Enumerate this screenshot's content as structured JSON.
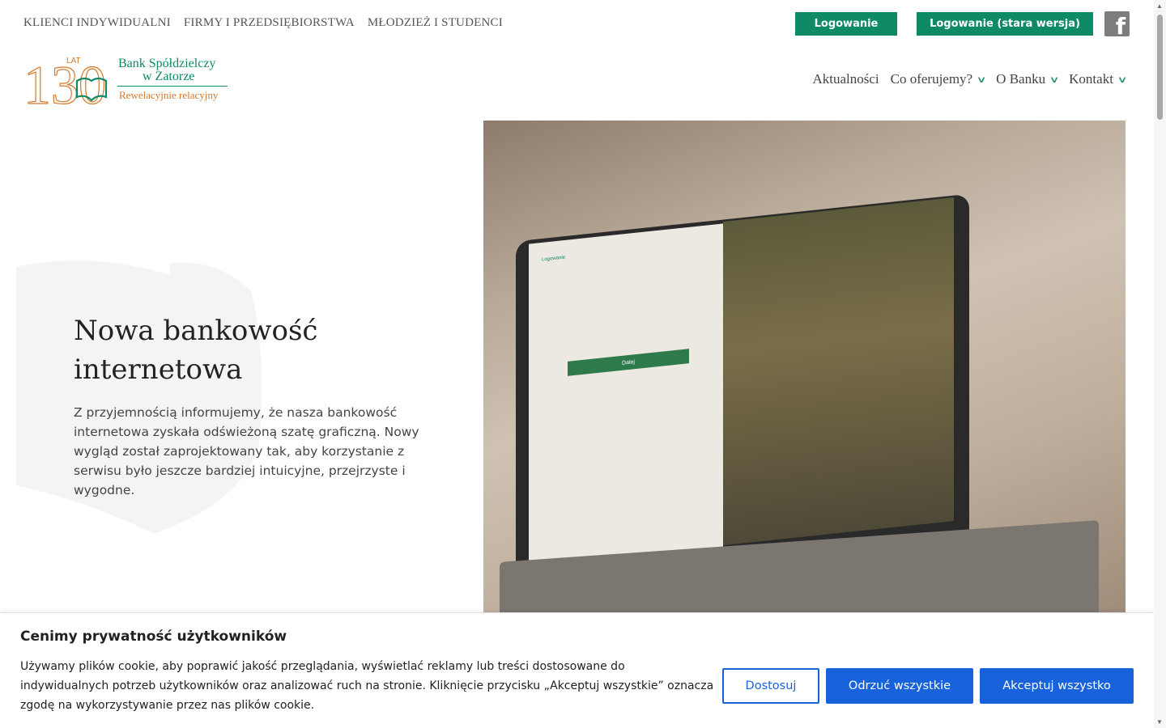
{
  "top_nav": [
    "KLIENCI INDYWIDUALNI",
    "FIRMY I PRZEDSIĘBIORSTWA",
    "MŁODZIEŻ I STUDENCI"
  ],
  "header_buttons": {
    "login": "Logowanie",
    "login_old": "Logowanie (stara wersja)"
  },
  "logo": {
    "years": "130",
    "lat": "LAT",
    "name_line1": "Bank Spółdzielczy",
    "name_line2": "w Zatorze",
    "tagline": "Rewelacyjnie relacyjny"
  },
  "main_nav": [
    "Aktualności",
    "Co oferujemy?",
    "O Banku",
    "Kontakt"
  ],
  "hero": {
    "title": "Nowa bankowość internetowa",
    "text": "Z przyjemnością informujemy, że nasza bankowość internetowa zyskała odświeżoną szatę graficzną. Nowy wygląd został zaprojektowany tak, aby korzystanie z serwisu było jeszcze bardziej intuicyjne, przejrzyste i wygodne."
  },
  "hero_screen": {
    "login": "Logowanie",
    "button": "Dalej"
  },
  "cookie": {
    "title": "Cenimy prywatność użytkowników",
    "text": "Używamy plików cookie, aby poprawić jakość przeglądania, wyświetlać reklamy lub treści dostosowane do indywidualnych potrzeb użytkowników oraz analizować ruch na stronie. Kliknięcie przycisku „Akceptuj wszystkie” oznacza zgodę na wykorzystywanie przez nas plików cookie.",
    "customize": "Dostosuj",
    "reject": "Odrzuć wszystkie",
    "accept": "Akceptuj wszystko"
  },
  "colors": {
    "brand_green": "#0e8a66",
    "brand_orange": "#d47a2c",
    "cookie_blue": "#1863dc"
  }
}
